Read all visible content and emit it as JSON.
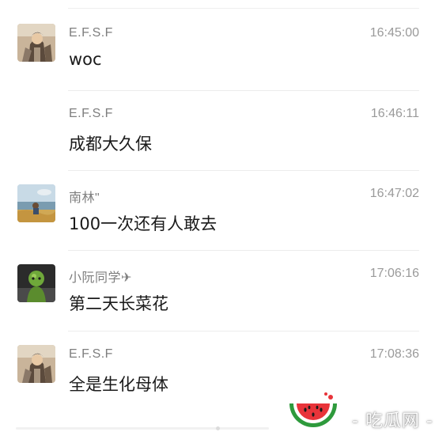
{
  "messages": [
    {
      "sender": "E.F.S.F",
      "time": "16:45:00",
      "text": "woc",
      "avatar": "anime-warrior-avatar"
    },
    {
      "sender": "E.F.S.F",
      "time": "16:46:11",
      "text": "成都大久保",
      "avatar": "none"
    },
    {
      "sender": "南林\"",
      "time": "16:47:02",
      "text": "100一次还有人敢去",
      "avatar": "lakeside-landscape-avatar"
    },
    {
      "sender": "小阮同学✈",
      "time": "17:06:16",
      "text": "第二天长菜花",
      "avatar": "green-figure-avatar"
    },
    {
      "sender": "E.F.S.F",
      "time": "17:08:36",
      "text": "全是生化母体",
      "avatar": "anime-warrior-avatar"
    }
  ],
  "watermark": {
    "text": "- 吃瓜网 -",
    "icon": "watermelon-icon"
  },
  "colors": {
    "sender": "#7e7e7e",
    "time": "#9a9a9a",
    "message": "#1a1a1a",
    "divider": "#ececec"
  }
}
